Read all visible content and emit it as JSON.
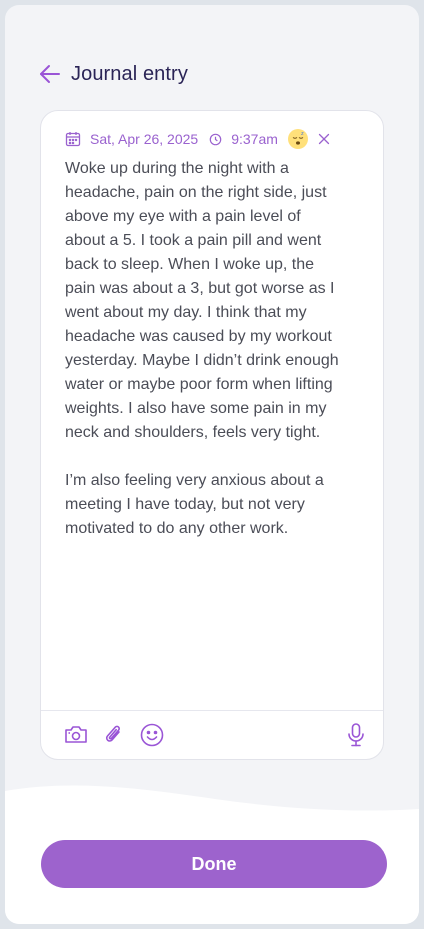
{
  "header": {
    "title": "Journal entry",
    "back_icon": "arrow-left-icon"
  },
  "entry": {
    "date": "Sat, Apr 26, 2025",
    "time": "9:37am",
    "mood_icon": "sleepy-face-icon",
    "text": "Woke up during the night with a\nheadache, pain on the right side, just\nabove my eye with a pain level of\nabout a 5. I took a pain pill and went\nback to sleep. When I woke up, the\npain was about a 3, but got worse as I\nwent about my day. I think that my\nheadache was caused by my workout\nyesterday. Maybe I didn’t drink enough\nwater or maybe poor form when lifting\nweights. I also have some pain in my\nneck and shoulders, feels very tight.\n\nI’m also feeling very anxious about a\nmeeting I have today, but not very\nmotivated to do any other work."
  },
  "toolbar": {
    "icons": [
      "camera-icon",
      "paperclip-icon",
      "smiley-icon",
      "microphone-icon"
    ]
  },
  "footer": {
    "done_label": "Done"
  },
  "colors": {
    "accent": "#9d63cd",
    "title": "#2a2456",
    "background": "#f3f4f7",
    "mood": "#ffe07a"
  }
}
